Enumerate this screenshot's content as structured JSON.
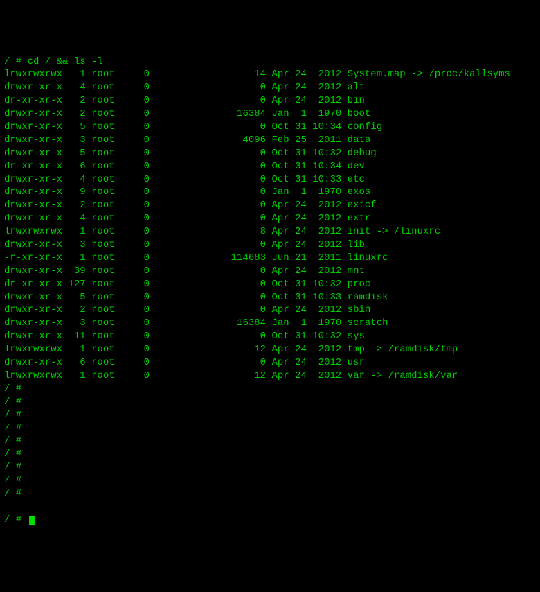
{
  "command_line": "/ # cd / && ls -l",
  "listing": [
    {
      "perm": "lrwxrwxrwx",
      "links": "1",
      "owner": "root",
      "group": "0",
      "size": "14",
      "month": "Apr",
      "day": "24",
      "time": "2012",
      "name": "System.map -> /proc/kallsyms"
    },
    {
      "perm": "drwxr-xr-x",
      "links": "4",
      "owner": "root",
      "group": "0",
      "size": "0",
      "month": "Apr",
      "day": "24",
      "time": "2012",
      "name": "alt"
    },
    {
      "perm": "dr-xr-xr-x",
      "links": "2",
      "owner": "root",
      "group": "0",
      "size": "0",
      "month": "Apr",
      "day": "24",
      "time": "2012",
      "name": "bin"
    },
    {
      "perm": "drwxr-xr-x",
      "links": "2",
      "owner": "root",
      "group": "0",
      "size": "16384",
      "month": "Jan",
      "day": "1",
      "time": "1970",
      "name": "boot"
    },
    {
      "perm": "drwxr-xr-x",
      "links": "5",
      "owner": "root",
      "group": "0",
      "size": "0",
      "month": "Oct",
      "day": "31",
      "time": "10:34",
      "name": "config"
    },
    {
      "perm": "drwxr-xr-x",
      "links": "3",
      "owner": "root",
      "group": "0",
      "size": "4096",
      "month": "Feb",
      "day": "25",
      "time": "2011",
      "name": "data"
    },
    {
      "perm": "drwxr-xr-x",
      "links": "5",
      "owner": "root",
      "group": "0",
      "size": "0",
      "month": "Oct",
      "day": "31",
      "time": "10:32",
      "name": "debug"
    },
    {
      "perm": "dr-xr-xr-x",
      "links": "6",
      "owner": "root",
      "group": "0",
      "size": "0",
      "month": "Oct",
      "day": "31",
      "time": "10:34",
      "name": "dev"
    },
    {
      "perm": "drwxr-xr-x",
      "links": "4",
      "owner": "root",
      "group": "0",
      "size": "0",
      "month": "Oct",
      "day": "31",
      "time": "10:33",
      "name": "etc"
    },
    {
      "perm": "drwxr-xr-x",
      "links": "9",
      "owner": "root",
      "group": "0",
      "size": "0",
      "month": "Jan",
      "day": "1",
      "time": "1970",
      "name": "exos"
    },
    {
      "perm": "drwxr-xr-x",
      "links": "2",
      "owner": "root",
      "group": "0",
      "size": "0",
      "month": "Apr",
      "day": "24",
      "time": "2012",
      "name": "extcf"
    },
    {
      "perm": "drwxr-xr-x",
      "links": "4",
      "owner": "root",
      "group": "0",
      "size": "0",
      "month": "Apr",
      "day": "24",
      "time": "2012",
      "name": "extr"
    },
    {
      "perm": "lrwxrwxrwx",
      "links": "1",
      "owner": "root",
      "group": "0",
      "size": "8",
      "month": "Apr",
      "day": "24",
      "time": "2012",
      "name": "init -> /linuxrc"
    },
    {
      "perm": "drwxr-xr-x",
      "links": "3",
      "owner": "root",
      "group": "0",
      "size": "0",
      "month": "Apr",
      "day": "24",
      "time": "2012",
      "name": "lib"
    },
    {
      "perm": "-r-xr-xr-x",
      "links": "1",
      "owner": "root",
      "group": "0",
      "size": "114683",
      "month": "Jun",
      "day": "21",
      "time": "2011",
      "name": "linuxrc"
    },
    {
      "perm": "drwxr-xr-x",
      "links": "39",
      "owner": "root",
      "group": "0",
      "size": "0",
      "month": "Apr",
      "day": "24",
      "time": "2012",
      "name": "mnt"
    },
    {
      "perm": "dr-xr-xr-x",
      "links": "127",
      "owner": "root",
      "group": "0",
      "size": "0",
      "month": "Oct",
      "day": "31",
      "time": "10:32",
      "name": "proc"
    },
    {
      "perm": "drwxr-xr-x",
      "links": "5",
      "owner": "root",
      "group": "0",
      "size": "0",
      "month": "Oct",
      "day": "31",
      "time": "10:33",
      "name": "ramdisk"
    },
    {
      "perm": "drwxr-xr-x",
      "links": "2",
      "owner": "root",
      "group": "0",
      "size": "0",
      "month": "Apr",
      "day": "24",
      "time": "2012",
      "name": "sbin"
    },
    {
      "perm": "drwxr-xr-x",
      "links": "3",
      "owner": "root",
      "group": "0",
      "size": "16384",
      "month": "Jan",
      "day": "1",
      "time": "1970",
      "name": "scratch"
    },
    {
      "perm": "drwxr-xr-x",
      "links": "11",
      "owner": "root",
      "group": "0",
      "size": "0",
      "month": "Oct",
      "day": "31",
      "time": "10:32",
      "name": "sys"
    },
    {
      "perm": "lrwxrwxrwx",
      "links": "1",
      "owner": "root",
      "group": "0",
      "size": "12",
      "month": "Apr",
      "day": "24",
      "time": "2012",
      "name": "tmp -> /ramdisk/tmp"
    },
    {
      "perm": "drwxr-xr-x",
      "links": "6",
      "owner": "root",
      "group": "0",
      "size": "0",
      "month": "Apr",
      "day": "24",
      "time": "2012",
      "name": "usr"
    },
    {
      "perm": "lrwxrwxrwx",
      "links": "1",
      "owner": "root",
      "group": "0",
      "size": "12",
      "month": "Apr",
      "day": "24",
      "time": "2012",
      "name": "var -> /ramdisk/var"
    }
  ],
  "prompt": "/ #",
  "empty_prompt_count": 9
}
